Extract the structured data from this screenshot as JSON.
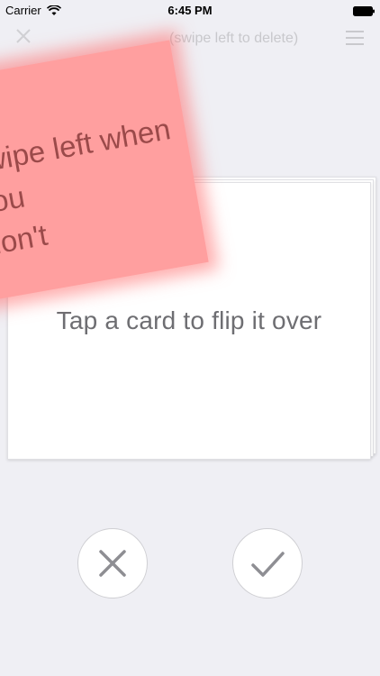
{
  "status_bar": {
    "carrier": "Carrier",
    "time": "6:45 PM"
  },
  "header": {
    "hint": "(swipe left to delete)"
  },
  "cards": {
    "front_text": "Tap a card to flip it over",
    "pink_text": "swipe left when you\ndon't"
  },
  "controls": {
    "reject_icon": "x-icon",
    "accept_icon": "check-icon"
  },
  "colors": {
    "accent_pink": "#ff9f9f",
    "control_gray": "#8e8e93"
  }
}
